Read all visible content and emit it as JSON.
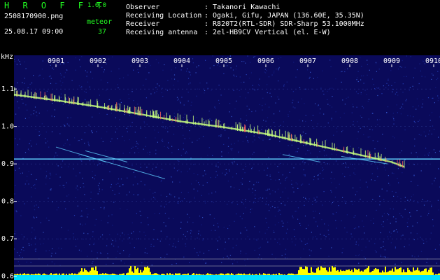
{
  "header": {
    "brand": "H R O F F T",
    "version": "1.0.0",
    "filename": "2508170900.png",
    "datetime": "25.08.17 09:00",
    "meteor_label": "meteor",
    "meteor_count": "37",
    "fields": [
      {
        "label": "Observer",
        "value": ": Takanori Kawachi"
      },
      {
        "label": "Receiving Location",
        "value": ": Ogaki, Gifu, JAPAN (136.60E, 35.35N)"
      },
      {
        "label": "Receiver",
        "value": ": R820T2(RTL-SDR) SDR-Sharp 53.1000MHz"
      },
      {
        "label": "Receiving antenna",
        "value": ": 2el-HB9CV Vertical (el. E-W)"
      }
    ]
  },
  "chart_data": {
    "type": "heatmap",
    "ylabel": "kHz",
    "x_tick_labels": [
      "0901",
      "0902",
      "0903",
      "0904",
      "0905",
      "0906",
      "0907",
      "0908",
      "0909",
      "0910"
    ],
    "y_ticks": [
      1.1,
      1.0,
      0.9,
      0.8,
      0.7,
      0.6
    ],
    "y_tick_labels": [
      "1.1",
      "1.0",
      "0.9",
      "0.8",
      "0.7",
      "0.6"
    ],
    "ylim": [
      0.59,
      1.19
    ],
    "xlim_minutes": [
      0,
      10
    ],
    "colors": {
      "background": "#0a0a5a",
      "carrier": "#5fd0ff",
      "trace": "#c8ff80",
      "strength_bar": "#ffff00",
      "strength_base": "#00e0ff",
      "text": "#22ff22"
    },
    "drifting_carrier": {
      "x_minutes": [
        0,
        1,
        2,
        3,
        4,
        5,
        6,
        7,
        8,
        9,
        9.3
      ],
      "freq_khz": [
        1.085,
        1.07,
        1.053,
        1.033,
        1.013,
        0.998,
        0.98,
        0.955,
        0.93,
        0.905,
        0.892
      ]
    },
    "fixed_carrier_khz": 0.913,
    "meteor_streaks": [
      {
        "x0": 1.0,
        "f0": 0.945,
        "x1": 2.2,
        "f1": 0.905
      },
      {
        "x0": 1.6,
        "f0": 0.925,
        "x1": 3.6,
        "f1": 0.86
      },
      {
        "x0": 1.7,
        "f0": 0.935,
        "x1": 2.7,
        "f1": 0.905
      },
      {
        "x0": 6.4,
        "f0": 0.925,
        "x1": 7.3,
        "f1": 0.905
      },
      {
        "x0": 7.8,
        "f0": 0.92,
        "x1": 8.9,
        "f1": 0.9
      }
    ]
  }
}
